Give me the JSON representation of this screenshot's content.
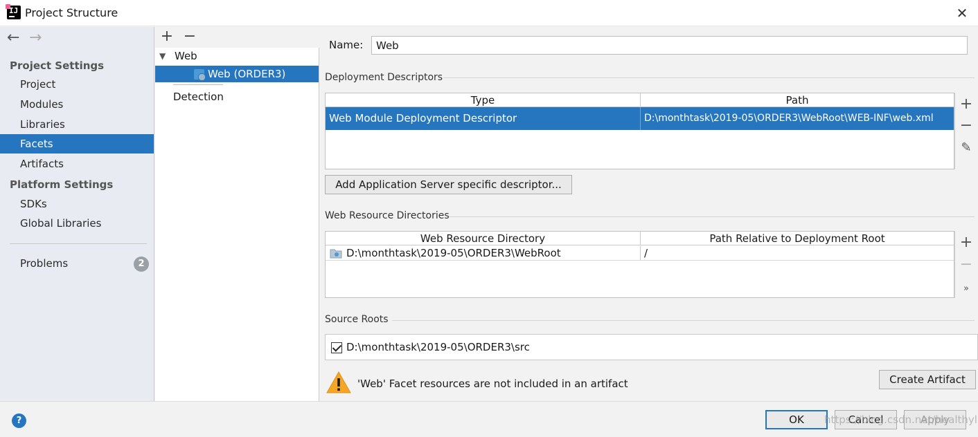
{
  "window": {
    "title": "Project Structure"
  },
  "sidebar": {
    "groups": [
      {
        "heading": "Project Settings",
        "items": [
          "Project",
          "Modules",
          "Libraries",
          "Facets",
          "Artifacts"
        ]
      },
      {
        "heading": "Platform Settings",
        "items": [
          "SDKs",
          "Global Libraries"
        ]
      }
    ],
    "problems": {
      "label": "Problems",
      "count": "2"
    },
    "selected": "Facets"
  },
  "tree": {
    "root": "Web",
    "child": "Web (ORDER3)",
    "detection": "Detection"
  },
  "facet": {
    "name_label": "Name:",
    "name_value": "Web",
    "deployment": {
      "title": "Deployment Descriptors",
      "columns": [
        "Type",
        "Path"
      ],
      "rows": [
        {
          "type": "Web Module Deployment Descriptor",
          "path": "D:\\monthtask\\2019-05\\ORDER3\\WebRoot\\WEB-INF\\web.xml"
        }
      ],
      "add_button": "Add Application Server specific descriptor..."
    },
    "web_resources": {
      "title": "Web Resource Directories",
      "columns": [
        "Web Resource Directory",
        "Path Relative to Deployment Root"
      ],
      "rows": [
        {
          "directory": "D:\\monthtask\\2019-05\\ORDER3\\WebRoot",
          "relative": "/"
        }
      ]
    },
    "source_roots": {
      "title": "Source Roots",
      "items": [
        {
          "path": "D:\\monthtask\\2019-05\\ORDER3\\src",
          "checked": true
        }
      ]
    },
    "warning": "'Web' Facet resources are not included in an artifact",
    "create_artifact_button": "Create Artifact"
  },
  "footer": {
    "ok": "OK",
    "cancel": "Cancel",
    "apply": "Apply",
    "watermark": "https://blog.csdn.net/healthylp"
  },
  "colors": {
    "selection": "#2675bf",
    "sidebar_bg": "#e8ebf1",
    "warning": "#f5a623"
  },
  "icons": [
    "intellij-logo-icon",
    "close-icon",
    "back-arrow-icon",
    "forward-arrow-icon",
    "plus-icon",
    "minus-icon",
    "edit-pencil-icon",
    "expand-more-icon",
    "folder-icon",
    "facet-web-icon",
    "warning-icon",
    "help-icon",
    "chevron-down-icon"
  ]
}
